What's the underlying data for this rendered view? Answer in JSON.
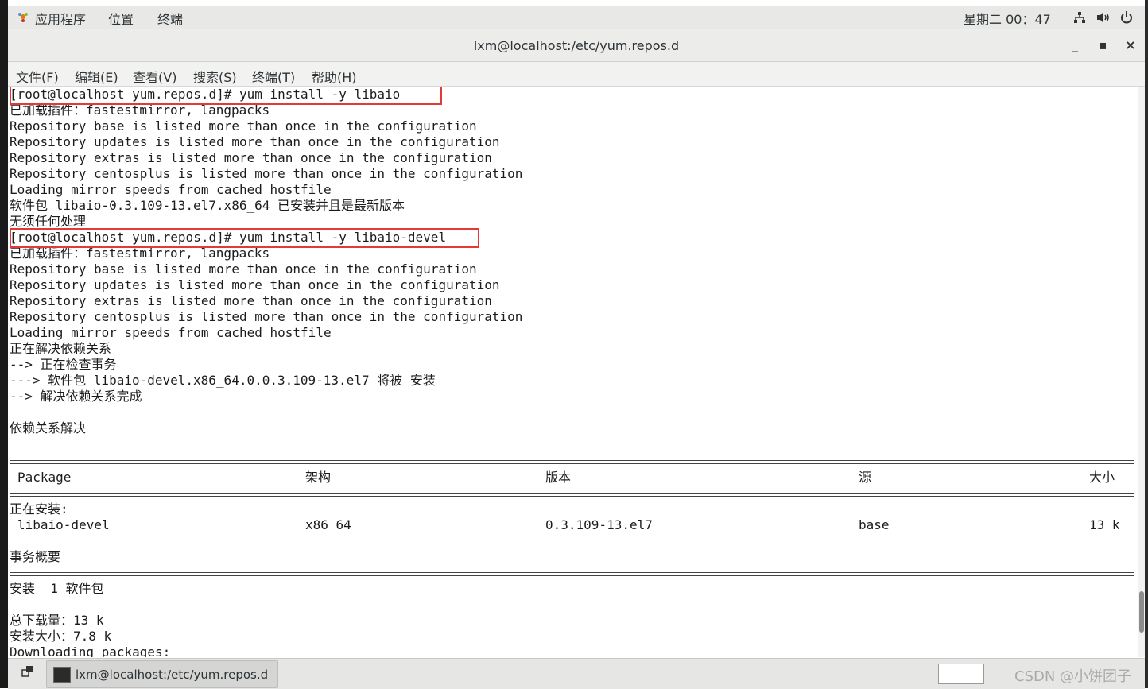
{
  "top_panel": {
    "apps_menu": "应用程序",
    "places_menu": "位置",
    "terminal_app": "终端",
    "clock": "星期二 00：47",
    "network_icon": "network-icon",
    "volume_icon": "volume-icon",
    "power_icon": "power-icon"
  },
  "window": {
    "title": "lxm@localhost:/etc/yum.repos.d",
    "minimize": "_",
    "maximize": "▪",
    "close": "×"
  },
  "menubar": [
    "文件(F)",
    "编辑(E)",
    "查看(V)",
    "搜索(S)",
    "终端(T)",
    "帮助(H)"
  ],
  "terminal": {
    "lines": [
      "[root@localhost yum.repos.d]# yum install -y libaio",
      "已加载插件：fastestmirror, langpacks",
      "Repository base is listed more than once in the configuration",
      "Repository updates is listed more than once in the configuration",
      "Repository extras is listed more than once in the configuration",
      "Repository centosplus is listed more than once in the configuration",
      "Loading mirror speeds from cached hostfile",
      "软件包 libaio-0.3.109-13.el7.x86_64 已安装并且是最新版本",
      "无须任何处理",
      "[root@localhost yum.repos.d]# yum install -y libaio-devel",
      "已加载插件：fastestmirror, langpacks",
      "Repository base is listed more than once in the configuration",
      "Repository updates is listed more than once in the configuration",
      "Repository extras is listed more than once in the configuration",
      "Repository centosplus is listed more than once in the configuration",
      "Loading mirror speeds from cached hostfile",
      "正在解决依赖关系",
      "--> 正在检查事务",
      "---> 软件包 libaio-devel.x86_64.0.0.3.109-13.el7 将被 安装",
      "--> 解决依赖关系完成",
      "",
      "依赖关系解决"
    ],
    "table_header": {
      "package": "Package",
      "arch": "架构",
      "version": "版本",
      "repo": "源",
      "size": "大小"
    },
    "installing_label": "正在安装:",
    "row": {
      "package": "libaio-devel",
      "arch": "x86_64",
      "version": "0.3.109-13.el7",
      "repo": "base",
      "size": "13 k"
    },
    "summary_label": "事务概要",
    "install_count": "安装  1 软件包",
    "total_download": "总下载量：13 k",
    "install_size": "安装大小：7.8 k",
    "downloading": "Downloading packages:"
  },
  "taskbar": {
    "task_title": "lxm@localhost:/etc/yum.repos.d",
    "watermark": "CSDN @小饼团子"
  }
}
